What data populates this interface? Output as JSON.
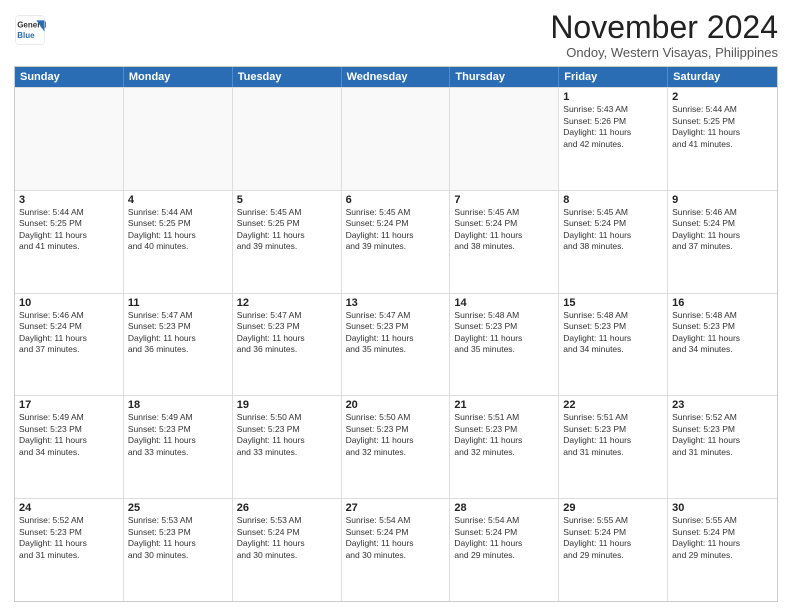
{
  "header": {
    "logo_line1": "General",
    "logo_line2": "Blue",
    "month_title": "November 2024",
    "location": "Ondoy, Western Visayas, Philippines"
  },
  "days_of_week": [
    "Sunday",
    "Monday",
    "Tuesday",
    "Wednesday",
    "Thursday",
    "Friday",
    "Saturday"
  ],
  "weeks": [
    [
      {
        "day": "",
        "info": ""
      },
      {
        "day": "",
        "info": ""
      },
      {
        "day": "",
        "info": ""
      },
      {
        "day": "",
        "info": ""
      },
      {
        "day": "",
        "info": ""
      },
      {
        "day": "1",
        "info": "Sunrise: 5:43 AM\nSunset: 5:26 PM\nDaylight: 11 hours\nand 42 minutes."
      },
      {
        "day": "2",
        "info": "Sunrise: 5:44 AM\nSunset: 5:25 PM\nDaylight: 11 hours\nand 41 minutes."
      }
    ],
    [
      {
        "day": "3",
        "info": "Sunrise: 5:44 AM\nSunset: 5:25 PM\nDaylight: 11 hours\nand 41 minutes."
      },
      {
        "day": "4",
        "info": "Sunrise: 5:44 AM\nSunset: 5:25 PM\nDaylight: 11 hours\nand 40 minutes."
      },
      {
        "day": "5",
        "info": "Sunrise: 5:45 AM\nSunset: 5:25 PM\nDaylight: 11 hours\nand 39 minutes."
      },
      {
        "day": "6",
        "info": "Sunrise: 5:45 AM\nSunset: 5:24 PM\nDaylight: 11 hours\nand 39 minutes."
      },
      {
        "day": "7",
        "info": "Sunrise: 5:45 AM\nSunset: 5:24 PM\nDaylight: 11 hours\nand 38 minutes."
      },
      {
        "day": "8",
        "info": "Sunrise: 5:45 AM\nSunset: 5:24 PM\nDaylight: 11 hours\nand 38 minutes."
      },
      {
        "day": "9",
        "info": "Sunrise: 5:46 AM\nSunset: 5:24 PM\nDaylight: 11 hours\nand 37 minutes."
      }
    ],
    [
      {
        "day": "10",
        "info": "Sunrise: 5:46 AM\nSunset: 5:24 PM\nDaylight: 11 hours\nand 37 minutes."
      },
      {
        "day": "11",
        "info": "Sunrise: 5:47 AM\nSunset: 5:23 PM\nDaylight: 11 hours\nand 36 minutes."
      },
      {
        "day": "12",
        "info": "Sunrise: 5:47 AM\nSunset: 5:23 PM\nDaylight: 11 hours\nand 36 minutes."
      },
      {
        "day": "13",
        "info": "Sunrise: 5:47 AM\nSunset: 5:23 PM\nDaylight: 11 hours\nand 35 minutes."
      },
      {
        "day": "14",
        "info": "Sunrise: 5:48 AM\nSunset: 5:23 PM\nDaylight: 11 hours\nand 35 minutes."
      },
      {
        "day": "15",
        "info": "Sunrise: 5:48 AM\nSunset: 5:23 PM\nDaylight: 11 hours\nand 34 minutes."
      },
      {
        "day": "16",
        "info": "Sunrise: 5:48 AM\nSunset: 5:23 PM\nDaylight: 11 hours\nand 34 minutes."
      }
    ],
    [
      {
        "day": "17",
        "info": "Sunrise: 5:49 AM\nSunset: 5:23 PM\nDaylight: 11 hours\nand 34 minutes."
      },
      {
        "day": "18",
        "info": "Sunrise: 5:49 AM\nSunset: 5:23 PM\nDaylight: 11 hours\nand 33 minutes."
      },
      {
        "day": "19",
        "info": "Sunrise: 5:50 AM\nSunset: 5:23 PM\nDaylight: 11 hours\nand 33 minutes."
      },
      {
        "day": "20",
        "info": "Sunrise: 5:50 AM\nSunset: 5:23 PM\nDaylight: 11 hours\nand 32 minutes."
      },
      {
        "day": "21",
        "info": "Sunrise: 5:51 AM\nSunset: 5:23 PM\nDaylight: 11 hours\nand 32 minutes."
      },
      {
        "day": "22",
        "info": "Sunrise: 5:51 AM\nSunset: 5:23 PM\nDaylight: 11 hours\nand 31 minutes."
      },
      {
        "day": "23",
        "info": "Sunrise: 5:52 AM\nSunset: 5:23 PM\nDaylight: 11 hours\nand 31 minutes."
      }
    ],
    [
      {
        "day": "24",
        "info": "Sunrise: 5:52 AM\nSunset: 5:23 PM\nDaylight: 11 hours\nand 31 minutes."
      },
      {
        "day": "25",
        "info": "Sunrise: 5:53 AM\nSunset: 5:23 PM\nDaylight: 11 hours\nand 30 minutes."
      },
      {
        "day": "26",
        "info": "Sunrise: 5:53 AM\nSunset: 5:24 PM\nDaylight: 11 hours\nand 30 minutes."
      },
      {
        "day": "27",
        "info": "Sunrise: 5:54 AM\nSunset: 5:24 PM\nDaylight: 11 hours\nand 30 minutes."
      },
      {
        "day": "28",
        "info": "Sunrise: 5:54 AM\nSunset: 5:24 PM\nDaylight: 11 hours\nand 29 minutes."
      },
      {
        "day": "29",
        "info": "Sunrise: 5:55 AM\nSunset: 5:24 PM\nDaylight: 11 hours\nand 29 minutes."
      },
      {
        "day": "30",
        "info": "Sunrise: 5:55 AM\nSunset: 5:24 PM\nDaylight: 11 hours\nand 29 minutes."
      }
    ]
  ]
}
